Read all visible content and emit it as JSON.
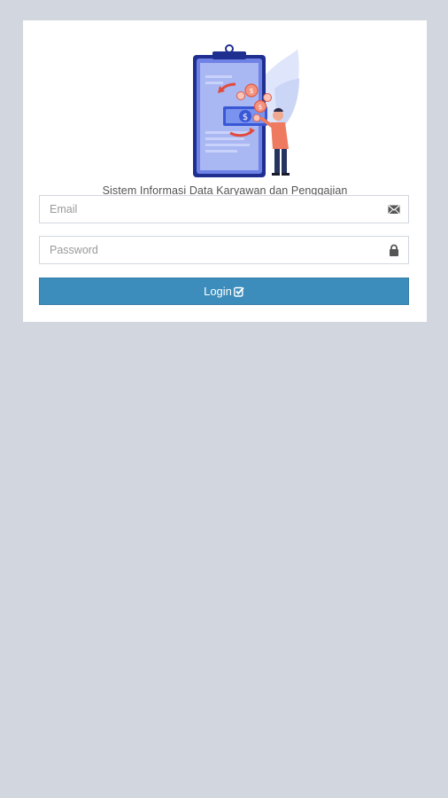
{
  "app": {
    "subtitle": "Sistem Informasi Data Karyawan dan Penggajian"
  },
  "form": {
    "email_placeholder": "Email",
    "email_value": "",
    "password_placeholder": "Password",
    "password_value": "",
    "login_label": "Login"
  },
  "icons": {
    "email_icon": "envelope-icon",
    "password_icon": "lock-icon",
    "login_icon": "check-square-icon"
  },
  "colors": {
    "background": "#d2d6de",
    "primary": "#3c8dbc",
    "card": "#ffffff"
  }
}
